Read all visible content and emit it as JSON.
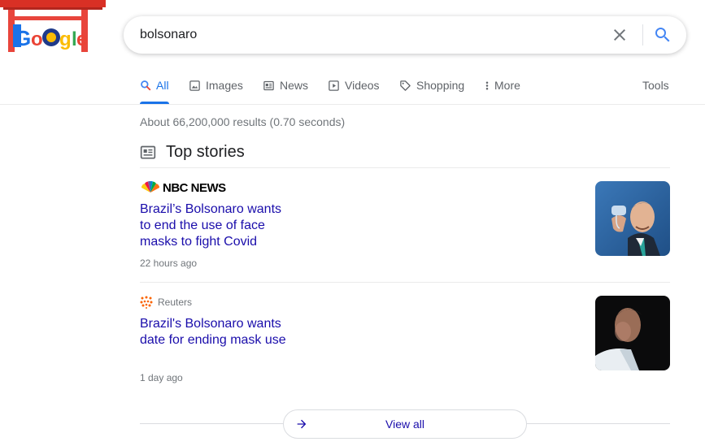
{
  "logo": {
    "text": "Google",
    "icon": "google-doodle-logo"
  },
  "search": {
    "query": "bolsonaro",
    "clear_icon": "close-icon",
    "search_icon": "search-icon"
  },
  "tabs": [
    {
      "label": "All",
      "icon": "search-icon",
      "active": true
    },
    {
      "label": "Images",
      "icon": "image-icon"
    },
    {
      "label": "News",
      "icon": "newspaper-icon"
    },
    {
      "label": "Videos",
      "icon": "play-icon"
    },
    {
      "label": "Shopping",
      "icon": "tag-icon"
    },
    {
      "label": "More",
      "icon": "more-vert-icon"
    }
  ],
  "tools_label": "Tools",
  "result_stats": "About 66,200,000 results (0.70 seconds)",
  "top_stories": {
    "title": "Top stories",
    "icon": "newspaper-icon",
    "stories": [
      {
        "source": "NBC NEWS",
        "source_icon": "nbc-peacock-icon",
        "title": "Brazil’s Bolsonaro wants to end the use of face masks to fight Covid",
        "time": "22 hours ago"
      },
      {
        "source": "Reuters",
        "source_icon": "reuters-dots-icon",
        "title": "Brazil's Bolsonaro wants date for ending mask use",
        "time": "1 day ago"
      }
    ]
  },
  "view_all": {
    "label": "View all",
    "icon": "arrow-right-icon"
  },
  "colors": {
    "accent": "#1a73e8",
    "link": "#1a0dab",
    "muted": "#70757a"
  }
}
